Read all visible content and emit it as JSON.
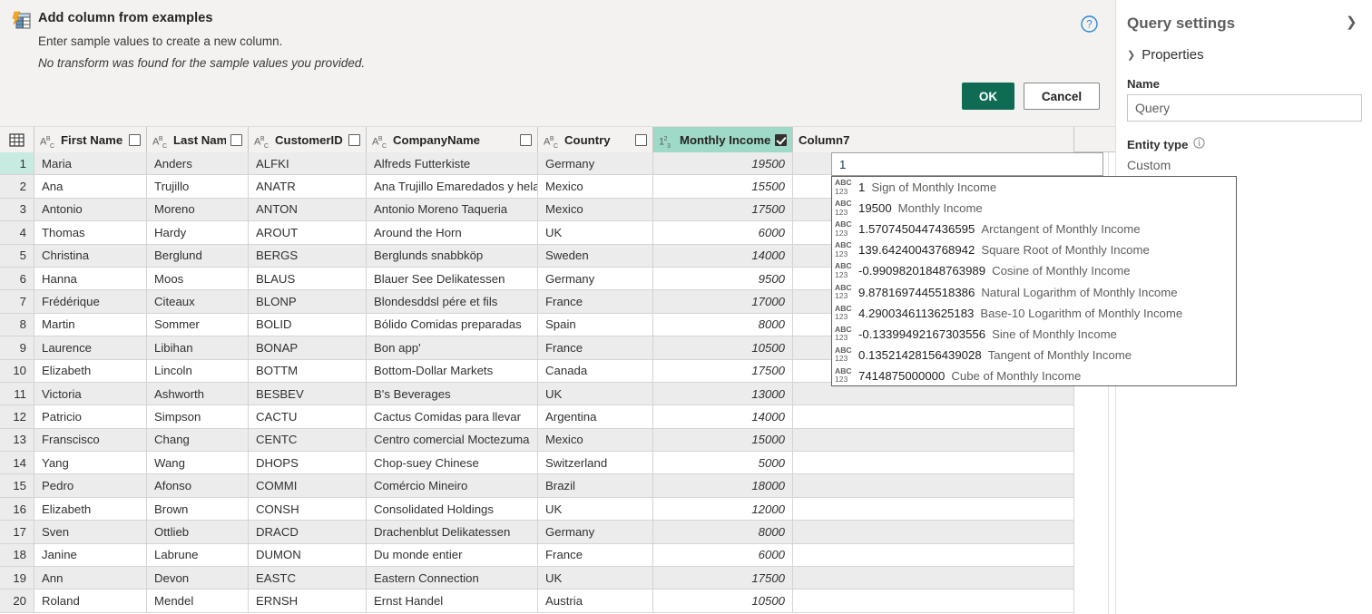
{
  "banner": {
    "icon": "add-column-from-examples-icon",
    "title": "Add column from examples",
    "subtitle": "Enter sample values to create a new column.",
    "note": "No transform was found for the sample values you provided.",
    "help_icon": "help-circle-icon",
    "ok_label": "OK",
    "cancel_label": "Cancel"
  },
  "grid": {
    "corner_icon": "select-all-table-icon",
    "columns": [
      {
        "key": "rownum",
        "label": "",
        "type": "",
        "checkbox": null,
        "width_class": "w-rn",
        "align": "right"
      },
      {
        "key": "first",
        "label": "First Name",
        "type": "ABC",
        "checkbox": false,
        "width_class": "w-fn",
        "align": "left"
      },
      {
        "key": "last",
        "label": "Last Name",
        "type": "ABC",
        "checkbox": false,
        "width_class": "w-ln",
        "align": "left"
      },
      {
        "key": "custid",
        "label": "CustomerID",
        "type": "ABC",
        "checkbox": false,
        "width_class": "w-cid",
        "align": "left"
      },
      {
        "key": "company",
        "label": "CompanyName",
        "type": "ABC",
        "checkbox": false,
        "width_class": "w-cn",
        "align": "left"
      },
      {
        "key": "country",
        "label": "Country",
        "type": "ABC",
        "checkbox": false,
        "width_class": "w-ctr",
        "align": "left"
      },
      {
        "key": "income",
        "label": "Monthly Income",
        "type": "123",
        "checkbox": true,
        "width_class": "w-mi",
        "align": "right"
      },
      {
        "key": "column7",
        "label": "Column7",
        "type": "",
        "checkbox": null,
        "width_class": "w-c7",
        "align": "left"
      }
    ],
    "rows": [
      {
        "n": "1",
        "first": "Maria",
        "last": "Anders",
        "custid": "ALFKI",
        "company": "Alfreds Futterkiste",
        "country": "Germany",
        "income": "19500"
      },
      {
        "n": "2",
        "first": "Ana",
        "last": "Trujillo",
        "custid": "ANATR",
        "company": "Ana Trujillo Emaredados y helados",
        "country": "Mexico",
        "income": "15500"
      },
      {
        "n": "3",
        "first": "Antonio",
        "last": "Moreno",
        "custid": "ANTON",
        "company": "Antonio Moreno Taqueria",
        "country": "Mexico",
        "income": "17500"
      },
      {
        "n": "4",
        "first": "Thomas",
        "last": "Hardy",
        "custid": "AROUT",
        "company": "Around the Horn",
        "country": "UK",
        "income": "6000"
      },
      {
        "n": "5",
        "first": "Christina",
        "last": "Berglund",
        "custid": "BERGS",
        "company": "Berglunds snabbköp",
        "country": "Sweden",
        "income": "14000"
      },
      {
        "n": "6",
        "first": "Hanna",
        "last": "Moos",
        "custid": "BLAUS",
        "company": "Blauer See Delikatessen",
        "country": "Germany",
        "income": "9500"
      },
      {
        "n": "7",
        "first": "Frédérique",
        "last": "Citeaux",
        "custid": "BLONP",
        "company": "Blondesddsl pére et fils",
        "country": "France",
        "income": "17000"
      },
      {
        "n": "8",
        "first": "Martin",
        "last": "Sommer",
        "custid": "BOLID",
        "company": "Bólido Comidas preparadas",
        "country": "Spain",
        "income": "8000"
      },
      {
        "n": "9",
        "first": "Laurence",
        "last": "Libihan",
        "custid": "BONAP",
        "company": "Bon app'",
        "country": "France",
        "income": "10500"
      },
      {
        "n": "10",
        "first": "Elizabeth",
        "last": "Lincoln",
        "custid": "BOTTM",
        "company": "Bottom-Dollar Markets",
        "country": "Canada",
        "income": "17500"
      },
      {
        "n": "11",
        "first": "Victoria",
        "last": "Ashworth",
        "custid": "BESBEV",
        "company": "B's Beverages",
        "country": "UK",
        "income": "13000"
      },
      {
        "n": "12",
        "first": "Patricio",
        "last": "Simpson",
        "custid": "CACTU",
        "company": "Cactus Comidas para llevar",
        "country": "Argentina",
        "income": "14000"
      },
      {
        "n": "13",
        "first": "Franscisco",
        "last": "Chang",
        "custid": "CENTC",
        "company": "Centro comercial Moctezuma",
        "country": "Mexico",
        "income": "15000"
      },
      {
        "n": "14",
        "first": "Yang",
        "last": "Wang",
        "custid": "DHOPS",
        "company": "Chop-suey Chinese",
        "country": "Switzerland",
        "income": "5000"
      },
      {
        "n": "15",
        "first": "Pedro",
        "last": "Afonso",
        "custid": "COMMI",
        "company": "Comércio Mineiro",
        "country": "Brazil",
        "income": "18000"
      },
      {
        "n": "16",
        "first": "Elizabeth",
        "last": "Brown",
        "custid": "CONSH",
        "company": "Consolidated Holdings",
        "country": "UK",
        "income": "12000"
      },
      {
        "n": "17",
        "first": "Sven",
        "last": "Ottlieb",
        "custid": "DRACD",
        "company": "Drachenblut Delikatessen",
        "country": "Germany",
        "income": "8000"
      },
      {
        "n": "18",
        "first": "Janine",
        "last": "Labrune",
        "custid": "DUMON",
        "company": "Du monde entier",
        "country": "France",
        "income": "6000"
      },
      {
        "n": "19",
        "first": "Ann",
        "last": "Devon",
        "custid": "EASTC",
        "company": "Eastern Connection",
        "country": "UK",
        "income": "17500"
      },
      {
        "n": "20",
        "first": "Roland",
        "last": "Mendel",
        "custid": "ERNSH",
        "company": "Ernst Handel",
        "country": "Austria",
        "income": "10500"
      }
    ]
  },
  "sample_input": {
    "value": "1",
    "placeholder": ""
  },
  "suggestions": {
    "type_badge_line1": "ABC",
    "type_badge_line2": "123",
    "items": [
      {
        "value": "1",
        "description": "Sign of Monthly Income"
      },
      {
        "value": "19500",
        "description": "Monthly Income"
      },
      {
        "value": "1.5707450447436595",
        "description": "Arctangent of Monthly Income"
      },
      {
        "value": "139.64240043768942",
        "description": "Square Root of Monthly Income"
      },
      {
        "value": "-0.99098201848763989",
        "description": "Cosine of Monthly Income"
      },
      {
        "value": "9.8781697445518386",
        "description": "Natural Logarithm of Monthly Income"
      },
      {
        "value": "4.2900346113625183",
        "description": "Base-10 Logarithm of Monthly Income"
      },
      {
        "value": "-0.13399492167303556",
        "description": "Sine of Monthly Income"
      },
      {
        "value": "0.13521428156439028",
        "description": "Tangent of Monthly Income"
      },
      {
        "value": "7414875000000",
        "description": "Cube of Monthly Income"
      }
    ]
  },
  "query_settings": {
    "title": "Query settings",
    "collapse_icon": "chevron-right-icon",
    "section_label": "Properties",
    "section_chevron": "chevron-down-icon",
    "name_label": "Name",
    "name_value": "Query",
    "entity_type_label": "Entity type",
    "entity_type_info_icon": "info-circle-icon",
    "entity_type_value": "Custom",
    "panel_icon": "database-step-icon"
  },
  "colors": {
    "accent_green": "#0f6b54",
    "selected_column": "#9fd9c7",
    "selected_row_number": "#c7ebe0",
    "banner_bg": "#f3f2f1",
    "help_blue": "#2b88d8"
  }
}
